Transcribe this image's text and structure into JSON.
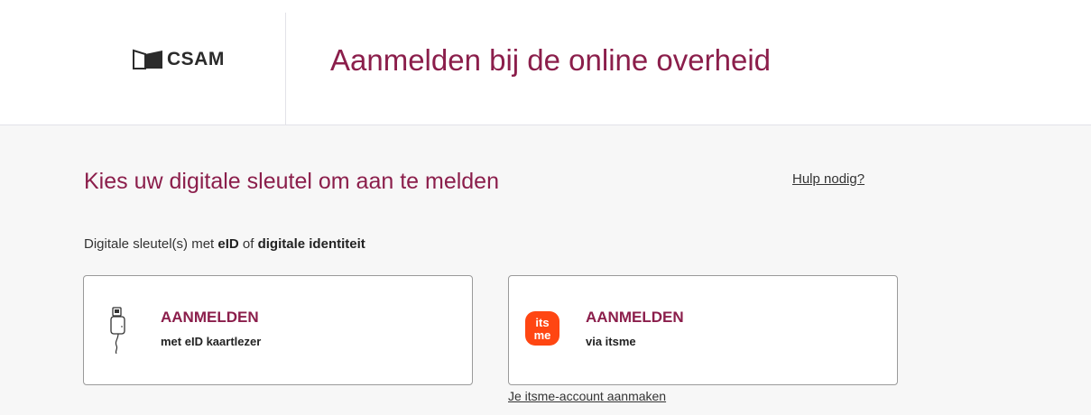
{
  "header": {
    "logo_text": "CSAM",
    "title": "Aanmelden bij de online overheid"
  },
  "main": {
    "subtitle": "Kies uw digitale sleutel om aan te melden",
    "help_link": "Hulp nodig?",
    "keys_intro": {
      "prefix": "Digitale sleutel(s) met ",
      "bold1": "eID",
      "middle": " of ",
      "bold2": "digitale identiteit"
    },
    "cards": [
      {
        "title": "AANMELDEN",
        "subtitle": "met eID kaartlezer",
        "icon": "card-reader-icon"
      },
      {
        "title": "AANMELDEN",
        "subtitle": "via itsme",
        "icon": "itsme-logo-icon"
      }
    ],
    "create_account_link": "Je itsme-account aanmaken"
  },
  "colors": {
    "accent": "#8b1e4b",
    "itsme_orange": "#ff4612",
    "panel_bg": "#f7f7f7"
  }
}
